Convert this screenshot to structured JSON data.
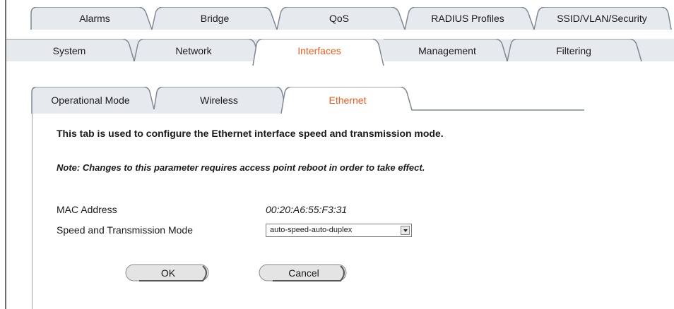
{
  "top_tabs": [
    "Alarms",
    "Bridge",
    "QoS",
    "RADIUS Profiles",
    "SSID/VLAN/Security"
  ],
  "main_tabs": [
    "System",
    "Network",
    "Interfaces",
    "Management",
    "Filtering"
  ],
  "sub_tabs": [
    "Operational Mode",
    "Wireless",
    "Ethernet"
  ],
  "active_main_tab": "Interfaces",
  "active_sub_tab": "Ethernet",
  "description": "This tab is used to configure the Ethernet interface speed and transmission mode.",
  "note": "Note: Changes to this parameter requires access point reboot in order to take effect.",
  "fields": {
    "mac_label": "MAC Address",
    "mac_value": "00:20:A6:55:F3:31",
    "speed_label": "Speed and Transmission Mode",
    "speed_value": "auto-speed-auto-duplex"
  },
  "buttons": {
    "ok": "OK",
    "cancel": "Cancel"
  },
  "colors": {
    "tab_fill": "#e6e9ed",
    "tab_outline": "#7f8894",
    "active_label": "#ef5b1c"
  }
}
